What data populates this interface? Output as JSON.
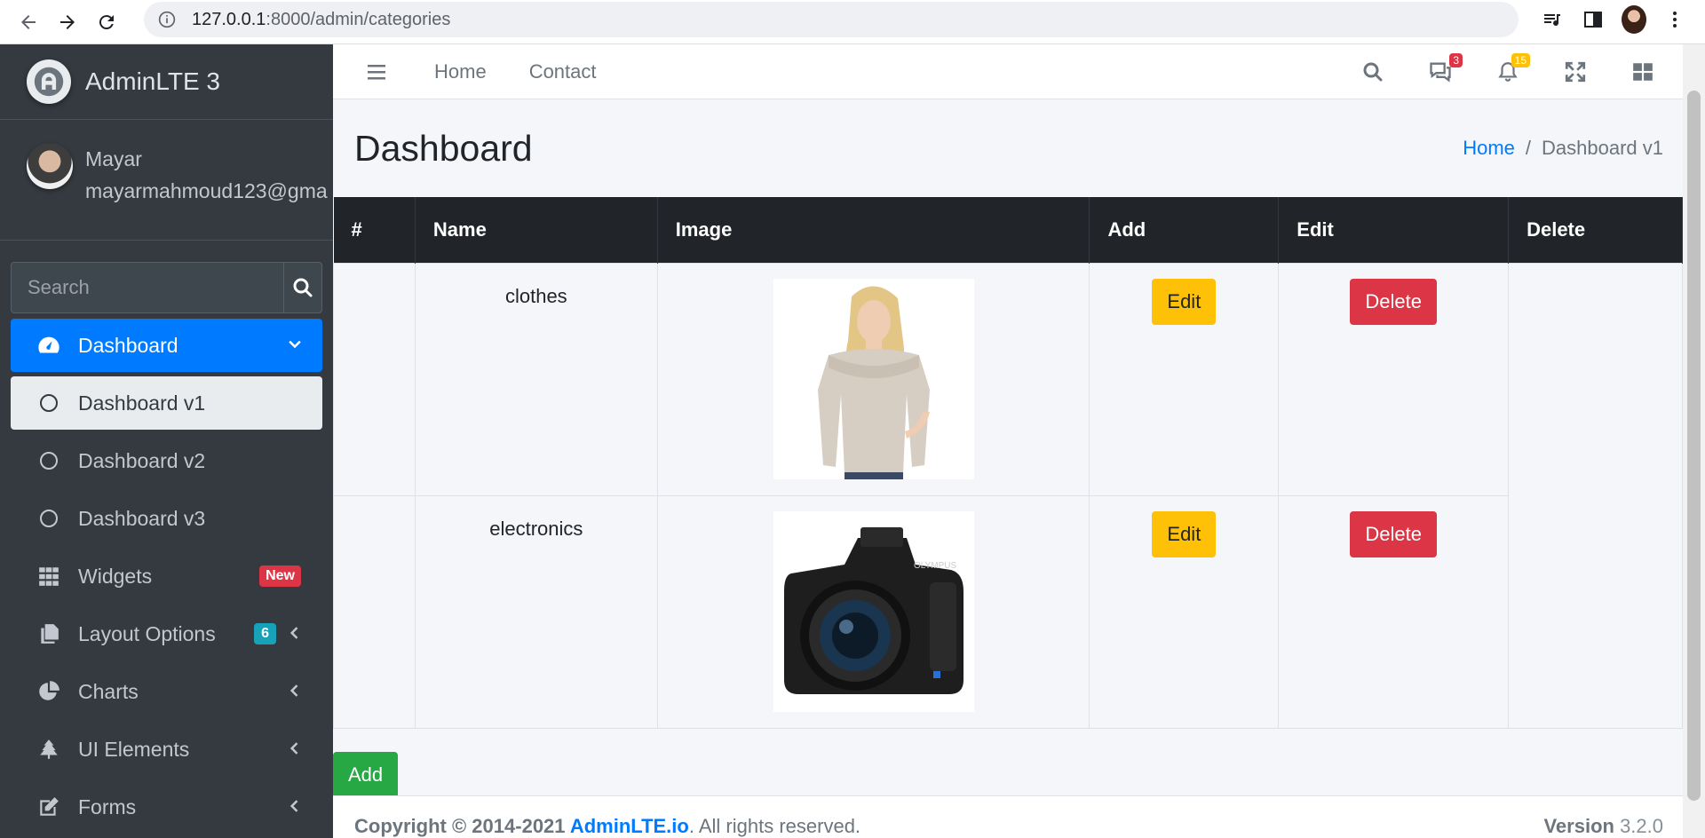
{
  "browser": {
    "url_host": "127.0.0.1",
    "url_path": ":8000/admin/categories"
  },
  "sidebar": {
    "brand": "AdminLTE 3",
    "user": {
      "name": "Mayar",
      "email": "mayarmahmoud123@gma"
    },
    "search_placeholder": "Search",
    "items": [
      {
        "label": "Dashboard",
        "icon": "tachometer-icon",
        "active": true
      },
      {
        "label": "Dashboard v1",
        "icon": "circle-icon",
        "sub_active": true
      },
      {
        "label": "Dashboard v2",
        "icon": "circle-icon"
      },
      {
        "label": "Dashboard v3",
        "icon": "circle-icon"
      },
      {
        "label": "Widgets",
        "icon": "grid-icon",
        "badge": "New"
      },
      {
        "label": "Layout Options",
        "icon": "copy-icon",
        "badge": "6"
      },
      {
        "label": "Charts",
        "icon": "pie-chart-icon"
      },
      {
        "label": "UI Elements",
        "icon": "tree-icon"
      },
      {
        "label": "Forms",
        "icon": "edit-icon"
      }
    ]
  },
  "topnav": {
    "links": [
      "Home",
      "Contact"
    ],
    "messages_count": "3",
    "notifications_count": "15"
  },
  "header": {
    "title": "Dashboard",
    "breadcrumb_home": "Home",
    "breadcrumb_sep": "/",
    "breadcrumb_current": "Dashboard v1"
  },
  "table": {
    "columns": [
      "#",
      "Name",
      "Image",
      "Add",
      "Edit",
      "Delete"
    ],
    "rows": [
      {
        "name": "clothes",
        "edit_label": "Edit",
        "delete_label": "Delete"
      },
      {
        "name": "electronics",
        "edit_label": "Edit",
        "delete_label": "Delete"
      }
    ]
  },
  "add_label": "Add",
  "footer": {
    "copyright": "Copyright © 2014-2021 ",
    "link": "AdminLTE.io",
    "rights": ". All rights reserved.",
    "version_label": "Version",
    "version": " 3.2.0"
  },
  "colors": {
    "sidebar_bg": "#343a40",
    "primary": "#007bff",
    "warning": "#ffc107",
    "danger": "#dc3545",
    "success": "#28a745",
    "info": "#17a2b8"
  }
}
